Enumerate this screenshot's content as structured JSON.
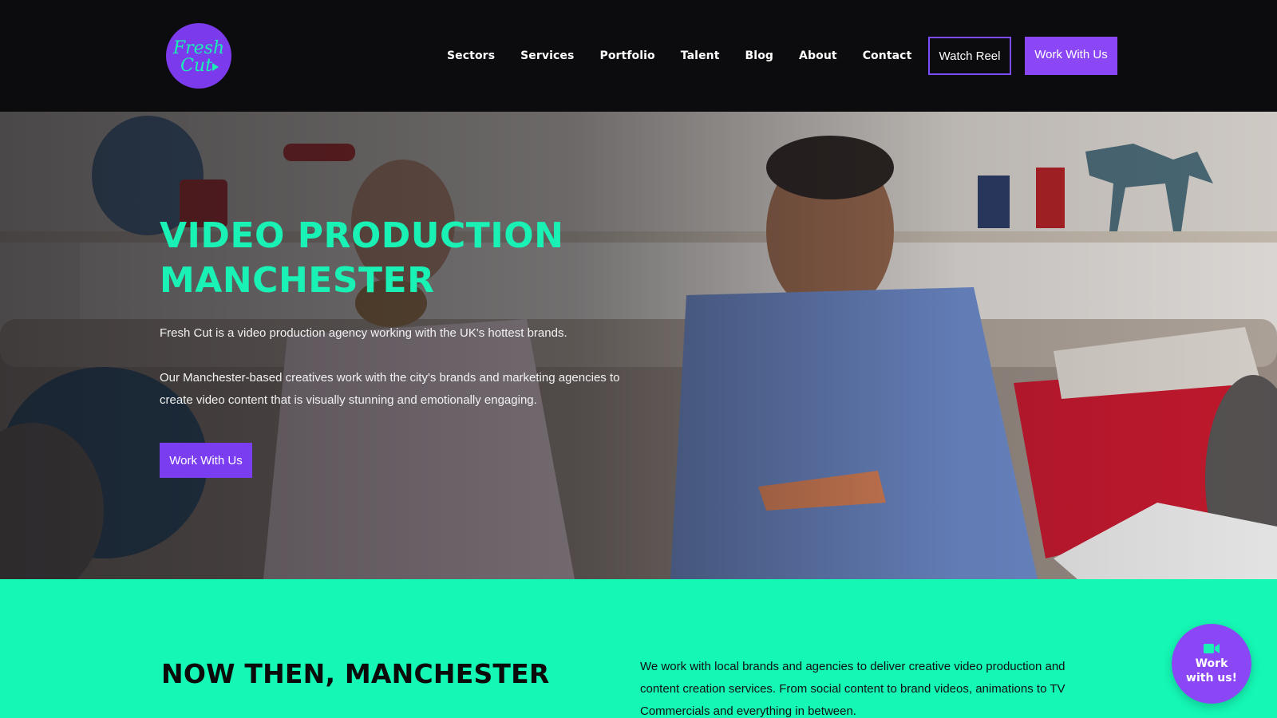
{
  "brand": {
    "logo_line1": "Fresh",
    "logo_line2": "Cut",
    "accent_purple": "#8b47f5",
    "accent_green": "#15f7b4",
    "header_bg": "#0c0c0e"
  },
  "nav": {
    "items": [
      {
        "label": "Sectors"
      },
      {
        "label": "Services"
      },
      {
        "label": "Portfolio"
      },
      {
        "label": "Talent"
      },
      {
        "label": "Blog"
      },
      {
        "label": "About"
      },
      {
        "label": "Contact"
      }
    ],
    "watch_reel_label": "Watch Reel",
    "work_with_us_label": "Work With Us"
  },
  "hero": {
    "title_line1": "VIDEO PRODUCTION",
    "title_line2": "MANCHESTER",
    "paragraph1": "Fresh Cut is a video production agency working with the UK's hottest brands.",
    "paragraph2": "Our Manchester-based creatives work with the city's brands and marketing agencies to create video content that is visually stunning and emotionally engaging.",
    "cta_label": "Work With Us"
  },
  "intro": {
    "title": "NOW THEN, MANCHESTER",
    "text": "We work with local brands and agencies to deliver creative video production and content creation services. From social content to brand videos, animations to TV Commercials and everything in between."
  },
  "floating_cta": {
    "icon": "video-camera-icon",
    "label": "Work with us!"
  }
}
